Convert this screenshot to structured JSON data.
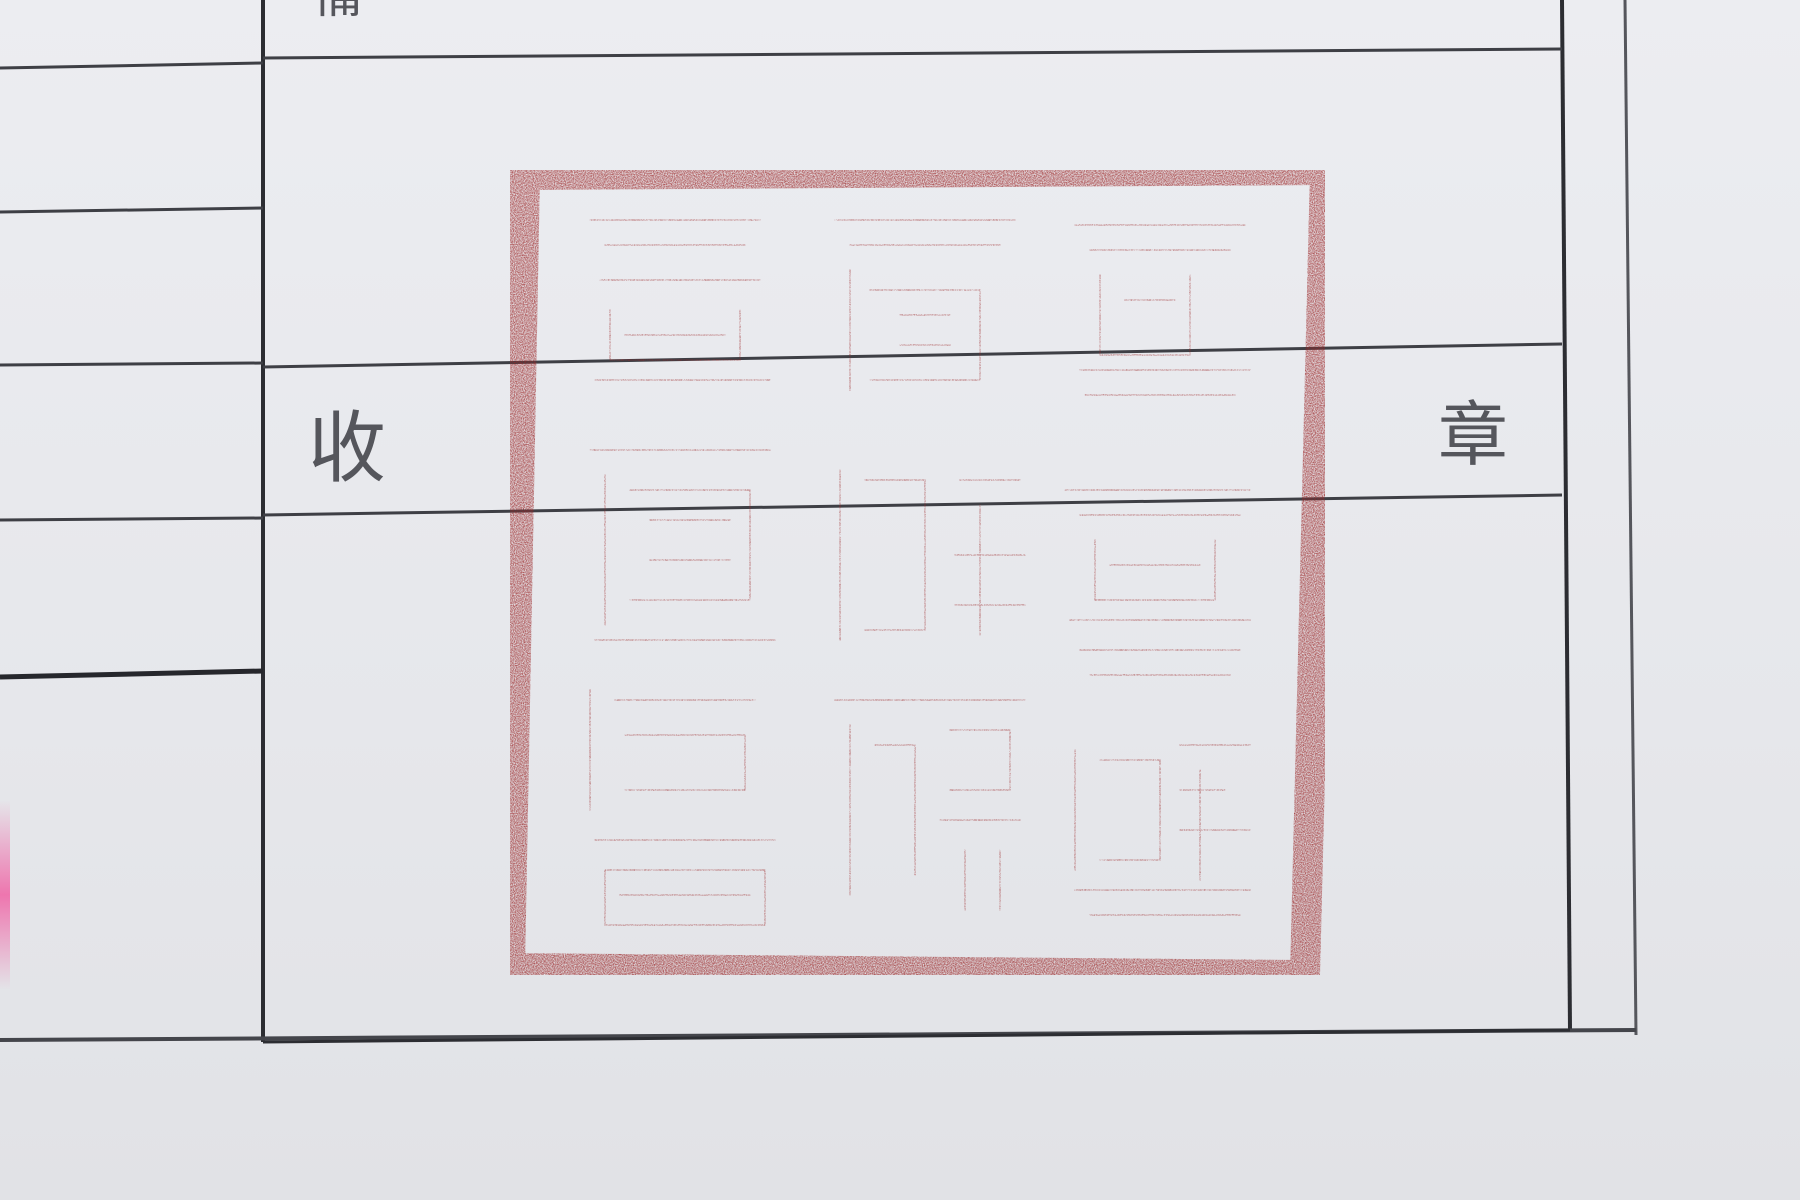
{
  "form": {
    "label_top": "備",
    "label_receive": "收",
    "label_stamp": "章"
  },
  "seal": {
    "characters": [
      "宣",
      "統",
      "御",
      "覽",
      "之",
      "寶",
      "善",
      "鑑",
      "歌",
      "詞",
      "德",
      "福",
      "無",
      "疆"
    ],
    "ink_color": "#9a2526",
    "paper_color": "#ecedf1",
    "line_color": "#333338"
  }
}
